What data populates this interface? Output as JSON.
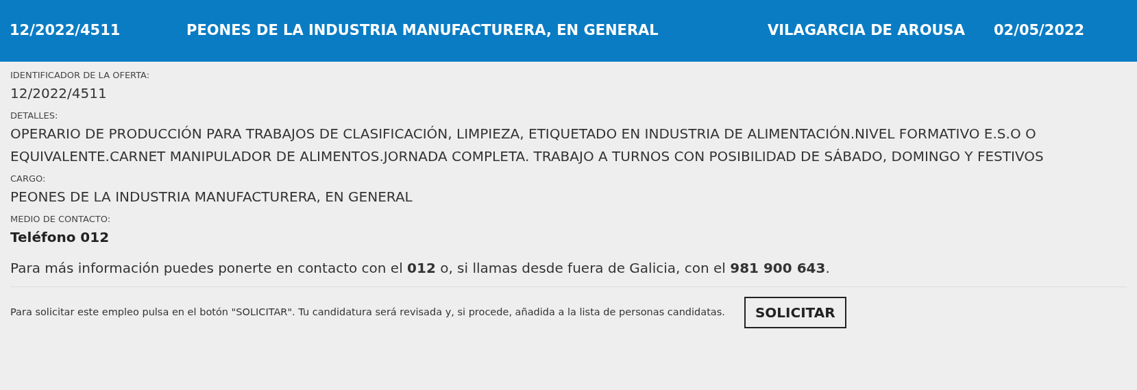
{
  "header": {
    "id": "12/2022/4511",
    "title": "PEONES DE LA INDUSTRIA MANUFACTURERA, EN GENERAL",
    "city": "VILAGARCIA DE AROUSA",
    "date": "02/05/2022"
  },
  "fields": [
    {
      "label": "IDENTIFICADOR DE LA OFERTA:",
      "value": "12/2022/4511",
      "kind": "plain"
    },
    {
      "label": "DETALLES:",
      "value": "OPERARIO DE PRODUCCIÓN PARA TRABAJOS DE CLASIFICACIÓN, LIMPIEZA, ETIQUETADO EN INDUSTRIA DE ALIMENTACIÓN.NIVEL FORMATIVO E.S.O O EQUIVALENTE.CARNET MANIPULADOR DE ALIMENTOS.JORNADA COMPLETA. TRABAJO A TURNOS CON POSIBILIDAD DE SÁBADO, DOMINGO Y FESTIVOS",
      "kind": "plain"
    },
    {
      "label": "CARGO:",
      "value": "PEONES DE LA INDUSTRIA MANUFACTURERA, EN GENERAL",
      "kind": "plain"
    },
    {
      "label": "MEDIO DE CONTACTO:",
      "value": "Teléfono 012",
      "kind": "strong"
    }
  ],
  "info": "Para más información puedes ponerte en contacto con el **012** o, si llamas desde fuera de Galicia, con el **981 900 643**.",
  "footer": {
    "text": "Para solicitar este empleo pulsa en el botón \"SOLICITAR\". Tu candidatura será revisada y, si procede, añadida a la lista de personas candidatas.",
    "button": "SOLICITAR"
  }
}
